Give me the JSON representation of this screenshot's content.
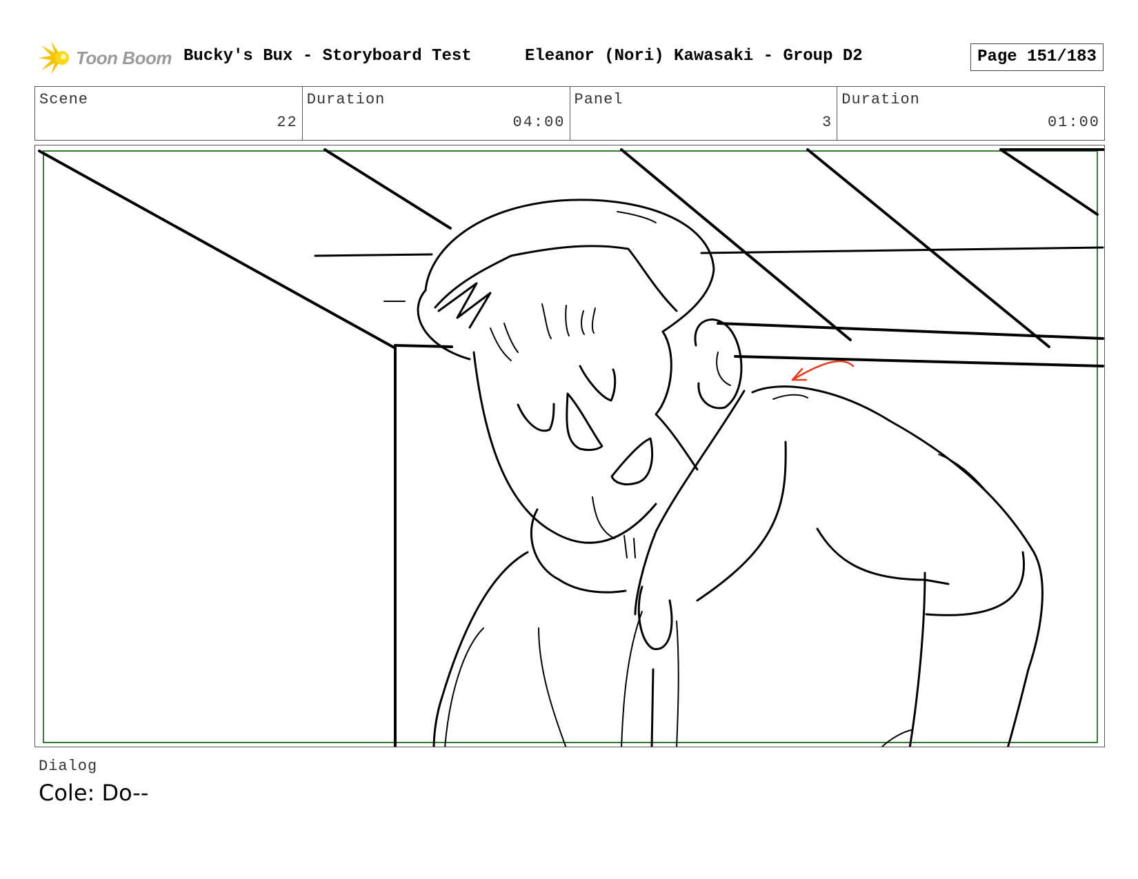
{
  "header": {
    "logo_text": "Toon Boom",
    "project_title": "Bucky's Bux - Storyboard Test",
    "artist": "Eleanor (Nori) Kawasaki - Group D2",
    "page": "Page 151/183"
  },
  "info": {
    "scene_label": "Scene",
    "scene_value": "22",
    "scene_duration_label": "Duration",
    "scene_duration_value": "04:00",
    "panel_label": "Panel",
    "panel_value": "3",
    "panel_duration_label": "Duration",
    "panel_duration_value": "01:00"
  },
  "dialog": {
    "label": "Dialog",
    "text": "Cole: Do--"
  },
  "colors": {
    "safe_frame": "#2e7d32",
    "annotation_arrow": "#e53a1e",
    "logo_burst": "#f5c400"
  }
}
